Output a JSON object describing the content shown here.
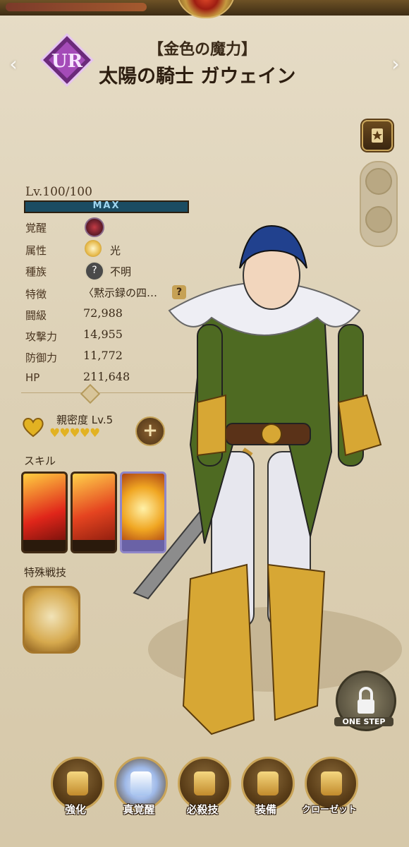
{
  "header": {
    "rarity": "UR",
    "subtitle": "【金色の魔力】",
    "name": "太陽の騎士 ガウェイン"
  },
  "level": {
    "text": "Lv.100/100",
    "bar_label": "MAX",
    "progress": 1.0
  },
  "stats": [
    {
      "label": "覚醒",
      "value": "",
      "icon": "awakening-gem-icon"
    },
    {
      "label": "属性",
      "value": "光",
      "icon": "light-attribute-icon"
    },
    {
      "label": "種族",
      "value": "不明",
      "icon": "unknown-race-icon"
    },
    {
      "label": "特徴",
      "value": "〈黙示録の四…",
      "icon": ""
    },
    {
      "label": "闘級",
      "value": "72,988",
      "icon": ""
    },
    {
      "label": "攻撃力",
      "value": "14,955",
      "icon": ""
    },
    {
      "label": "防御力",
      "value": "11,772",
      "icon": ""
    },
    {
      "label": "HP",
      "value": "211,648",
      "icon": ""
    }
  ],
  "trait_help": "?",
  "affinity": {
    "label": "親密度 Lv.5",
    "hearts": "♥♥♥♥♥",
    "plus": "+"
  },
  "sections": {
    "skills": "スキル",
    "special": "特殊戦技"
  },
  "one_step": "ONE STEP",
  "nav": [
    {
      "label": "強化",
      "icon": "helmet-upgrade-icon"
    },
    {
      "label": "真覚醒",
      "icon": "true-awakening-icon"
    },
    {
      "label": "必殺技",
      "icon": "ultimate-emblem-icon"
    },
    {
      "label": "装備",
      "icon": "equipment-icon"
    },
    {
      "label": "クローゼット",
      "icon": "closet-mannequin-icon"
    }
  ],
  "colors": {
    "accent_gold": "#c9a458",
    "level_bar": "#1b4c62",
    "heart": "#e2b222"
  }
}
